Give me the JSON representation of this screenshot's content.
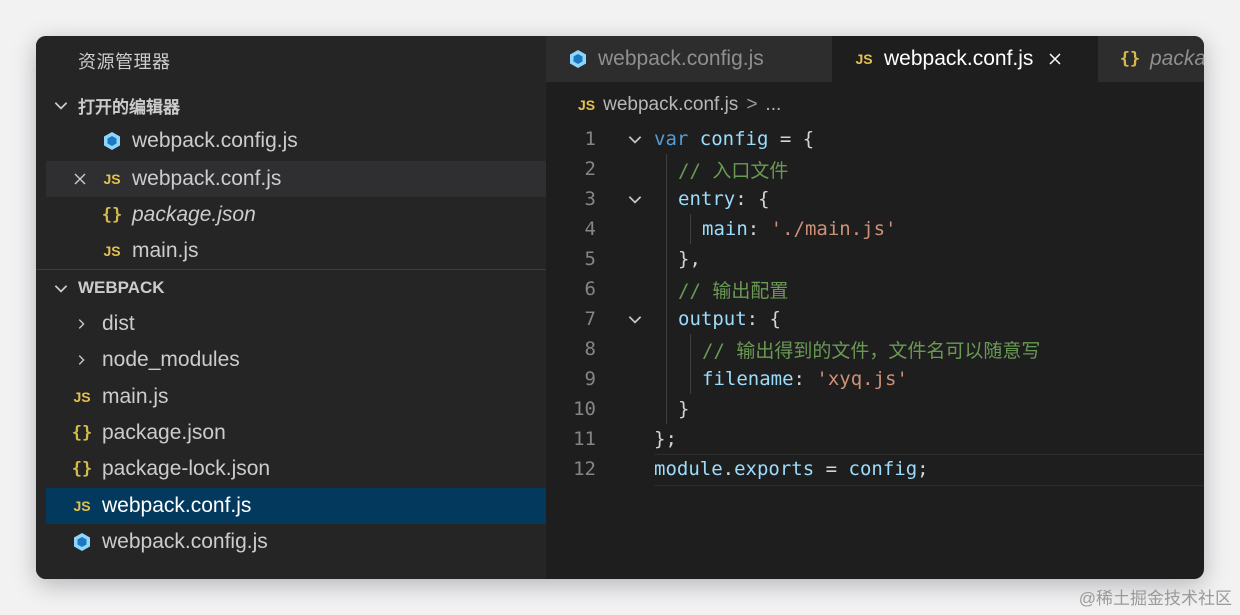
{
  "sidebar": {
    "title": "资源管理器",
    "open_editors_header": "打开的编辑器",
    "open_editors": [
      {
        "label": "webpack.config.js",
        "icon": "webpack-icon"
      },
      {
        "label": "webpack.conf.js",
        "icon": "js-icon",
        "js": "JS"
      },
      {
        "label": "package.json",
        "icon": "json-icon",
        "json": "{}"
      },
      {
        "label": "main.js",
        "icon": "js-icon",
        "js": "JS"
      }
    ],
    "project_header": "WEBPACK",
    "files": [
      {
        "label": "dist",
        "type": "folder"
      },
      {
        "label": "node_modules",
        "type": "folder"
      },
      {
        "label": "main.js",
        "icon": "js-icon",
        "js": "JS"
      },
      {
        "label": "package.json",
        "icon": "json-icon",
        "json": "{}"
      },
      {
        "label": "package-lock.json",
        "icon": "json-icon",
        "json": "{}"
      },
      {
        "label": "webpack.conf.js",
        "icon": "js-icon",
        "js": "JS"
      },
      {
        "label": "webpack.config.js",
        "icon": "webpack-icon"
      }
    ]
  },
  "tabs": [
    {
      "label": "webpack.config.js",
      "icon": "webpack-icon"
    },
    {
      "label": "webpack.conf.js",
      "icon": "js-icon",
      "js": "JS"
    },
    {
      "label": "packa",
      "icon": "json-icon",
      "json": "{}"
    }
  ],
  "breadcrumb": {
    "js": "JS",
    "file": "webpack.conf.js",
    "sep": ">",
    "more": "..."
  },
  "code": {
    "line_numbers": [
      "1",
      "2",
      "3",
      "4",
      "5",
      "6",
      "7",
      "8",
      "9",
      "10",
      "11",
      "12"
    ],
    "l1": {
      "kw": "var",
      "name": "config",
      "rest": " = {"
    },
    "l2": "// 入口文件",
    "l3": {
      "key": "entry",
      "rest": ": {"
    },
    "l4": {
      "key": "main",
      "colon": ": ",
      "str": "'./main.js'"
    },
    "l5": "},",
    "l6": "// 输出配置",
    "l7": {
      "key": "output",
      "rest": ": {"
    },
    "l8": "// 输出得到的文件，文件名可以随意写",
    "l9": {
      "key": "filename",
      "colon": ": ",
      "str": "'xyq.js'"
    },
    "l10": "}",
    "l11": "};",
    "l12": {
      "obj": "module",
      "dot": ".",
      "prop": "exports",
      "eq": " = ",
      "val": "config",
      "end": ";"
    }
  },
  "watermark": "@稀土掘金技术社区",
  "colors": {
    "selected": "#04395e",
    "js_icon": "#e3c14c",
    "keyword": "#569cd6",
    "string": "#ce9178",
    "comment": "#6a9955"
  }
}
